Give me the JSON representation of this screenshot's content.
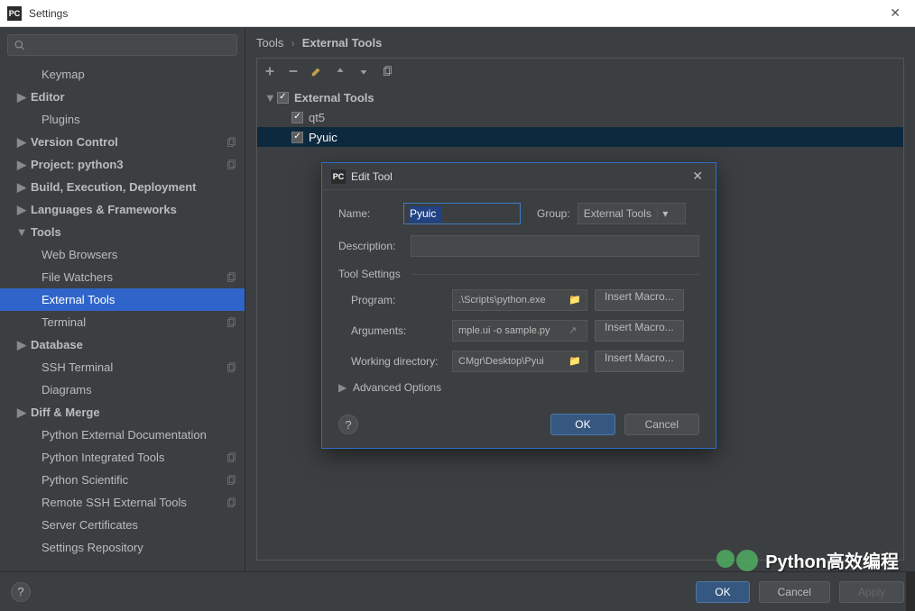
{
  "titlebar": {
    "title": "Settings"
  },
  "search": {
    "placeholder": ""
  },
  "sidebar": {
    "items": [
      {
        "label": "Keymap",
        "level": 1,
        "expandable": false
      },
      {
        "label": "Editor",
        "level": 0,
        "expandable": true,
        "expanded": false
      },
      {
        "label": "Plugins",
        "level": 1,
        "expandable": false
      },
      {
        "label": "Version Control",
        "level": 0,
        "expandable": true,
        "expanded": false,
        "copy": true
      },
      {
        "label": "Project: python3",
        "level": 0,
        "expandable": true,
        "expanded": false,
        "copy": true
      },
      {
        "label": "Build, Execution, Deployment",
        "level": 0,
        "expandable": true,
        "expanded": false
      },
      {
        "label": "Languages & Frameworks",
        "level": 0,
        "expandable": true,
        "expanded": false
      },
      {
        "label": "Tools",
        "level": 0,
        "expandable": true,
        "expanded": true
      },
      {
        "label": "Web Browsers",
        "level": 1
      },
      {
        "label": "File Watchers",
        "level": 1,
        "copy": true
      },
      {
        "label": "External Tools",
        "level": 1,
        "selected": true
      },
      {
        "label": "Terminal",
        "level": 1,
        "copy": true
      },
      {
        "label": "Database",
        "level": 0,
        "expandable": true,
        "expanded": false
      },
      {
        "label": "SSH Terminal",
        "level": 1,
        "copy": true
      },
      {
        "label": "Diagrams",
        "level": 1
      },
      {
        "label": "Diff & Merge",
        "level": 0,
        "expandable": true,
        "expanded": false
      },
      {
        "label": "Python External Documentation",
        "level": 1
      },
      {
        "label": "Python Integrated Tools",
        "level": 1,
        "copy": true
      },
      {
        "label": "Python Scientific",
        "level": 1,
        "copy": true
      },
      {
        "label": "Remote SSH External Tools",
        "level": 1,
        "copy": true
      },
      {
        "label": "Server Certificates",
        "level": 1
      },
      {
        "label": "Settings Repository",
        "level": 1
      }
    ]
  },
  "breadcrumb": {
    "root": "Tools",
    "sep": "›",
    "leaf": "External Tools"
  },
  "content_tree": {
    "root": "External Tools",
    "items": [
      {
        "label": "qt5",
        "checked": true
      },
      {
        "label": "Pyuic",
        "checked": true,
        "selected": true
      }
    ]
  },
  "footer": {
    "ok": "OK",
    "cancel": "Cancel",
    "apply": "Apply"
  },
  "watermark": {
    "text": "Python高效编程"
  },
  "dialog": {
    "title": "Edit Tool",
    "name_label": "Name:",
    "name_value": "Pyuic",
    "group_label": "Group:",
    "group_value": "External Tools",
    "desc_label": "Description:",
    "desc_value": "",
    "tool_settings": "Tool Settings",
    "program_label": "Program:",
    "program_value": ".\\Scripts\\python.exe",
    "arguments_label": "Arguments:",
    "arguments_value": "mple.ui -o sample.py",
    "workdir_label": "Working directory:",
    "workdir_value": "CMgr\\Desktop\\Pyui",
    "insert_macro": "Insert Macro...",
    "advanced": "Advanced Options",
    "ok": "OK",
    "cancel": "Cancel"
  }
}
